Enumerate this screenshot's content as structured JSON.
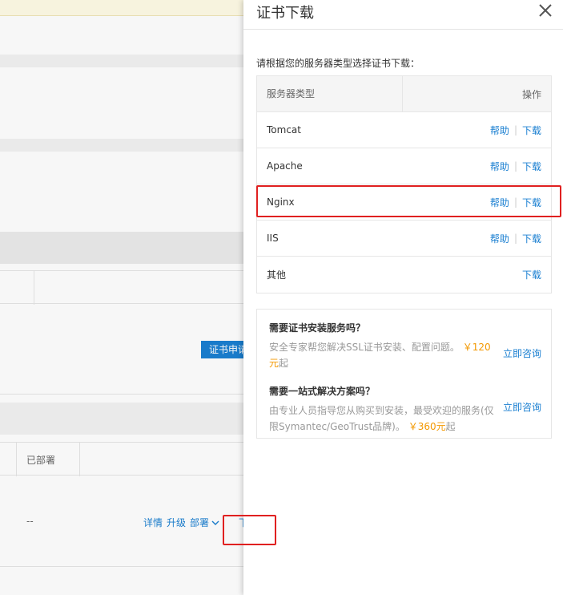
{
  "background": {
    "button_apply": "证书申请",
    "col_deployed": "已部署",
    "row_value": "--",
    "actions": [
      "详情",
      "升级",
      "部署"
    ],
    "partial_link": "下"
  },
  "drawer": {
    "title": "证书下载",
    "instruction": "请根据您的服务器类型选择证书下载：",
    "table": {
      "col_type": "服务器类型",
      "col_op": "操作",
      "rows": [
        {
          "name": "Tomcat",
          "help": "帮助",
          "download": "下载"
        },
        {
          "name": "Apache",
          "help": "帮助",
          "download": "下载"
        },
        {
          "name": "Nginx",
          "help": "帮助",
          "download": "下载"
        },
        {
          "name": "IIS",
          "help": "帮助",
          "download": "下载"
        },
        {
          "name": "其他",
          "download": "下载"
        }
      ]
    },
    "services": [
      {
        "title": "需要证书安装服务吗？",
        "desc_pre": "安全专家帮您解决SSL证书安装、配置问题。",
        "price": "￥120元",
        "desc_post": "起",
        "link": "立即咨询"
      },
      {
        "title": "需要一站式解决方案吗？",
        "desc_pre": "由专业人员指导您从购买到安装，最受欢迎的服务(仅限Symantec/GeoTrust品牌)。",
        "price": "￥360元",
        "desc_post": "起",
        "link": "立即咨询"
      }
    ]
  },
  "colors": {
    "link": "#1a7fd1",
    "highlight": "#e02020",
    "price": "#f39800",
    "button": "#1a7fd1"
  }
}
